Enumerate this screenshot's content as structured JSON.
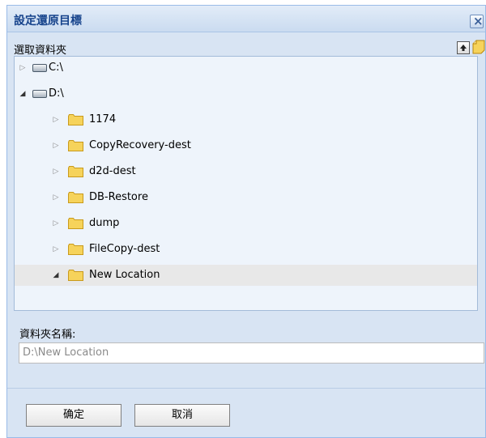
{
  "dialog": {
    "title": "設定還原目標",
    "close_icon": "close-icon",
    "folder_select_label": "選取資料夾",
    "folder_name_label": "資料夾名稱:",
    "folder_name_value": "D:\\New Location",
    "ok_label": "确定",
    "cancel_label": "取消"
  },
  "tree": {
    "drives": [
      {
        "label": "C:\\",
        "expanded": false
      },
      {
        "label": "D:\\",
        "expanded": true
      }
    ],
    "folders": [
      {
        "label": "1174",
        "expanded": false,
        "selected": false
      },
      {
        "label": "CopyRecovery-dest",
        "expanded": false,
        "selected": false
      },
      {
        "label": "d2d-dest",
        "expanded": false,
        "selected": false
      },
      {
        "label": "DB-Restore",
        "expanded": false,
        "selected": false
      },
      {
        "label": "dump",
        "expanded": false,
        "selected": false
      },
      {
        "label": "FileCopy-dest",
        "expanded": false,
        "selected": false
      },
      {
        "label": "New Location",
        "expanded": true,
        "selected": true
      }
    ]
  },
  "toolbar": {
    "up_icon": "up-arrow-icon",
    "new_folder_icon": "new-folder-icon"
  },
  "colors": {
    "title_text": "#15428b",
    "folder_fill": "#f6d35b",
    "dialog_bg": "#d8e4f3",
    "tree_bg": "#eef4fb",
    "selection_bg": "#e8e8e8"
  }
}
